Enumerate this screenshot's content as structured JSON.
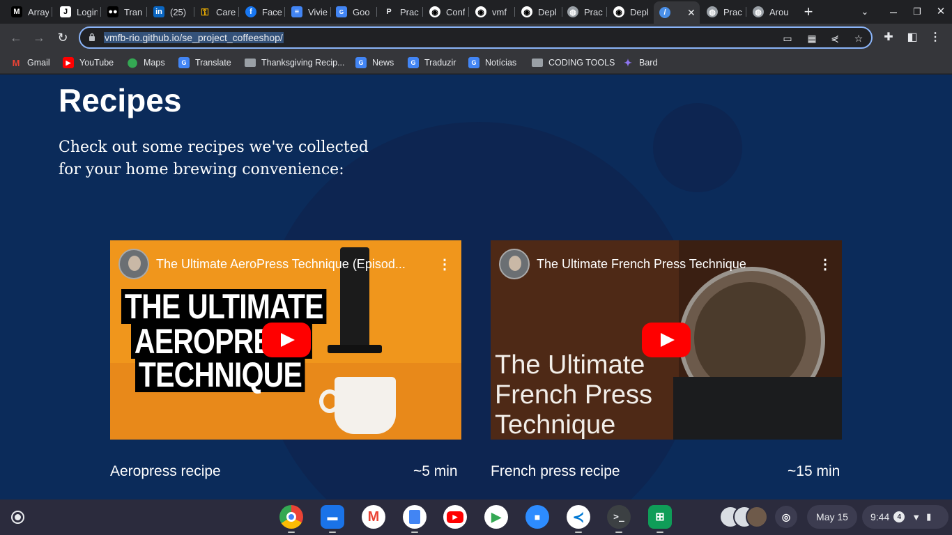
{
  "tabs": [
    {
      "title": "Array",
      "icon": "medium-icon",
      "color": "#000000"
    },
    {
      "title": "Login",
      "icon": "j-icon",
      "color": "#000000"
    },
    {
      "title": "Tran",
      "icon": "medium-dots-icon",
      "color": "#000000"
    },
    {
      "title": "(25)",
      "icon": "linkedin-icon",
      "color": "#0a66c2"
    },
    {
      "title": "Care",
      "icon": "key-icon",
      "color": "#f5b400"
    },
    {
      "title": "Face",
      "icon": "facebook-icon",
      "color": "#1877f2"
    },
    {
      "title": "Vivie",
      "icon": "docs-icon",
      "color": "#4285f4"
    },
    {
      "title": "Goo",
      "icon": "translate-icon",
      "color": "#4285f4"
    },
    {
      "title": "Prac",
      "icon": "p-icon",
      "color": "#202124"
    },
    {
      "title": "Conf",
      "icon": "github-icon",
      "color": "#ffffff"
    },
    {
      "title": "vmf",
      "icon": "github-icon",
      "color": "#ffffff"
    },
    {
      "title": "Depl",
      "icon": "github-icon",
      "color": "#ffffff"
    },
    {
      "title": "Prac",
      "icon": "globe-icon",
      "color": "#9aa0a6"
    },
    {
      "title": "Depl",
      "icon": "github-icon",
      "color": "#ffffff"
    },
    {
      "title": "",
      "icon": "bean-icon",
      "color": "#4a8fe7",
      "active": true
    },
    {
      "title": "Prac",
      "icon": "globe-icon",
      "color": "#9aa0a6"
    },
    {
      "title": "Arou",
      "icon": "globe-icon",
      "color": "#9aa0a6"
    }
  ],
  "toolbar": {
    "url": "vmfb-rio.github.io/se_project_coffeeshop/"
  },
  "bookmarks": [
    {
      "label": "Gmail",
      "icon": "gmail-icon",
      "color": "#ea4335"
    },
    {
      "label": "YouTube",
      "icon": "youtube-icon",
      "color": "#ff0000"
    },
    {
      "label": "Maps",
      "icon": "maps-icon",
      "color": "#34a853"
    },
    {
      "label": "Translate",
      "icon": "translate-icon",
      "color": "#4285f4"
    },
    {
      "label": "Thanksgiving Recip...",
      "icon": "folder-icon",
      "color": "#9aa0a6"
    },
    {
      "label": "News",
      "icon": "news-icon",
      "color": "#4285f4"
    },
    {
      "label": "Traduzir",
      "icon": "translate-icon",
      "color": "#4285f4"
    },
    {
      "label": "Notícias",
      "icon": "news-icon",
      "color": "#4285f4"
    },
    {
      "label": "CODING TOOLS",
      "icon": "folder-icon",
      "color": "#9aa0a6"
    },
    {
      "label": "Bard",
      "icon": "bard-icon",
      "color": "#8e75f0"
    }
  ],
  "page": {
    "title": "Recipes",
    "lead": "Check out some recipes we've collected for your home brewing convenience:",
    "videos": [
      {
        "title": "The Ultimate AeroPress Technique (Episod...",
        "thumb_lines": [
          "THE ULTIMATE",
          "AEROPRESS",
          "TECHNIQUE"
        ],
        "caption": "Aeropress recipe",
        "duration": "~5 min"
      },
      {
        "title": "The Ultimate French Press Technique",
        "thumb_lines": [
          "The Ultimate",
          "French Press",
          "Technique"
        ],
        "caption": "French press recipe",
        "duration": "~15 min"
      }
    ]
  },
  "shelf": {
    "apps": [
      {
        "name": "chrome-icon",
        "color": "#4285f4"
      },
      {
        "name": "files-icon",
        "color": "#1a73e8"
      },
      {
        "name": "gmail-icon",
        "color": "#ffffff"
      },
      {
        "name": "docs-icon",
        "color": "#4285f4"
      },
      {
        "name": "youtube-icon",
        "color": "#ff0000"
      },
      {
        "name": "play-store-icon",
        "color": "#ffffff"
      },
      {
        "name": "zoom-icon",
        "color": "#2d8cff"
      },
      {
        "name": "vscode-icon",
        "color": "#ffffff"
      },
      {
        "name": "terminal-icon",
        "color": "#3c4043"
      },
      {
        "name": "sheets-icon",
        "color": "#0f9d58"
      }
    ],
    "date": "May 15",
    "time": "9:44",
    "notification_count": "4"
  }
}
